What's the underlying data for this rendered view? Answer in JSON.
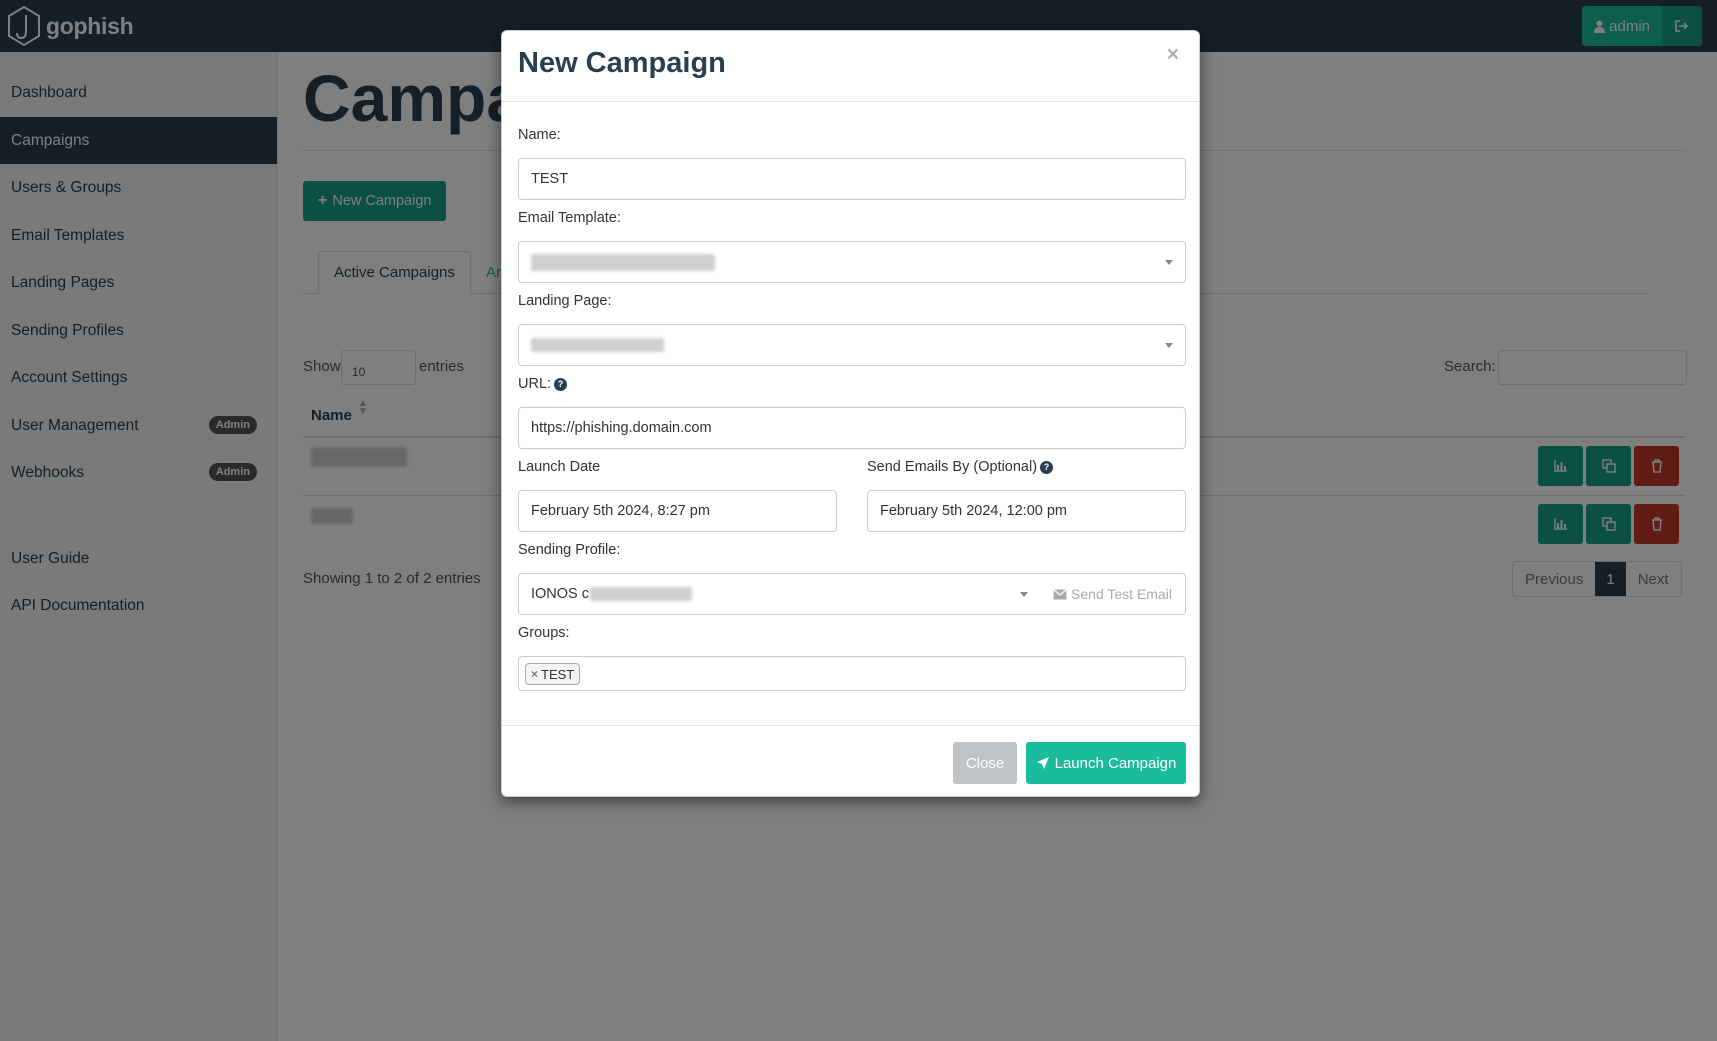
{
  "brand": {
    "name": "gophish"
  },
  "user_menu": {
    "user_label": "admin",
    "icons": {
      "user": "user-icon",
      "logout": "sign-out-icon"
    }
  },
  "sidebar": {
    "items": [
      {
        "label": "Dashboard",
        "active": false
      },
      {
        "label": "Campaigns",
        "active": true
      },
      {
        "label": "Users & Groups",
        "active": false
      },
      {
        "label": "Email Templates",
        "active": false
      },
      {
        "label": "Landing Pages",
        "active": false
      },
      {
        "label": "Sending Profiles",
        "active": false
      },
      {
        "label": "Account Settings",
        "active": false
      },
      {
        "label": "User Management",
        "active": false,
        "badge": "Admin"
      },
      {
        "label": "Webhooks",
        "active": false,
        "badge": "Admin"
      },
      {
        "label": "User Guide",
        "active": false
      },
      {
        "label": "API Documentation",
        "active": false
      }
    ]
  },
  "main": {
    "title": "Campai",
    "new_campaign_label": "New Campaign",
    "tabs": [
      {
        "label": "Active Campaigns",
        "active": true
      },
      {
        "label": "Ar",
        "active": false
      }
    ],
    "show_label": "Show",
    "page_size": "10",
    "entries_label": "entries",
    "search_label": "Search:",
    "table": {
      "columns": [
        "Name"
      ],
      "row_count": 2
    },
    "showing_text": "Showing 1 to 2 of 2 entries",
    "pagination": {
      "previous": "Previous",
      "current": "1",
      "next": "Next"
    }
  },
  "modal": {
    "title": "New Campaign",
    "close_symbol": "×",
    "name_label": "Name:",
    "name_value": "TEST",
    "email_template_label": "Email Template:",
    "landing_page_label": "Landing Page:",
    "url_label": "URL:",
    "url_value": "https://phishing.domain.com",
    "launch_date_label": "Launch Date",
    "launch_date_value": "February 5th 2024, 8:27 pm",
    "send_by_label": "Send Emails By (Optional)",
    "send_by_value": "February 5th 2024, 12:00 pm",
    "sending_profile_label": "Sending Profile:",
    "sending_profile_value": "IONOS c",
    "send_test_label": "Send Test Email",
    "groups_label": "Groups:",
    "groups": [
      {
        "label": "TEST",
        "remove_symbol": "×"
      }
    ],
    "close_button": "Close",
    "launch_button": "Launch Campaign"
  },
  "colors": {
    "navbar": "#283f50",
    "accent": "#1abc9c",
    "accent_dark": "#16a085",
    "danger": "#c0392b",
    "muted_button": "#bdc3c7"
  }
}
